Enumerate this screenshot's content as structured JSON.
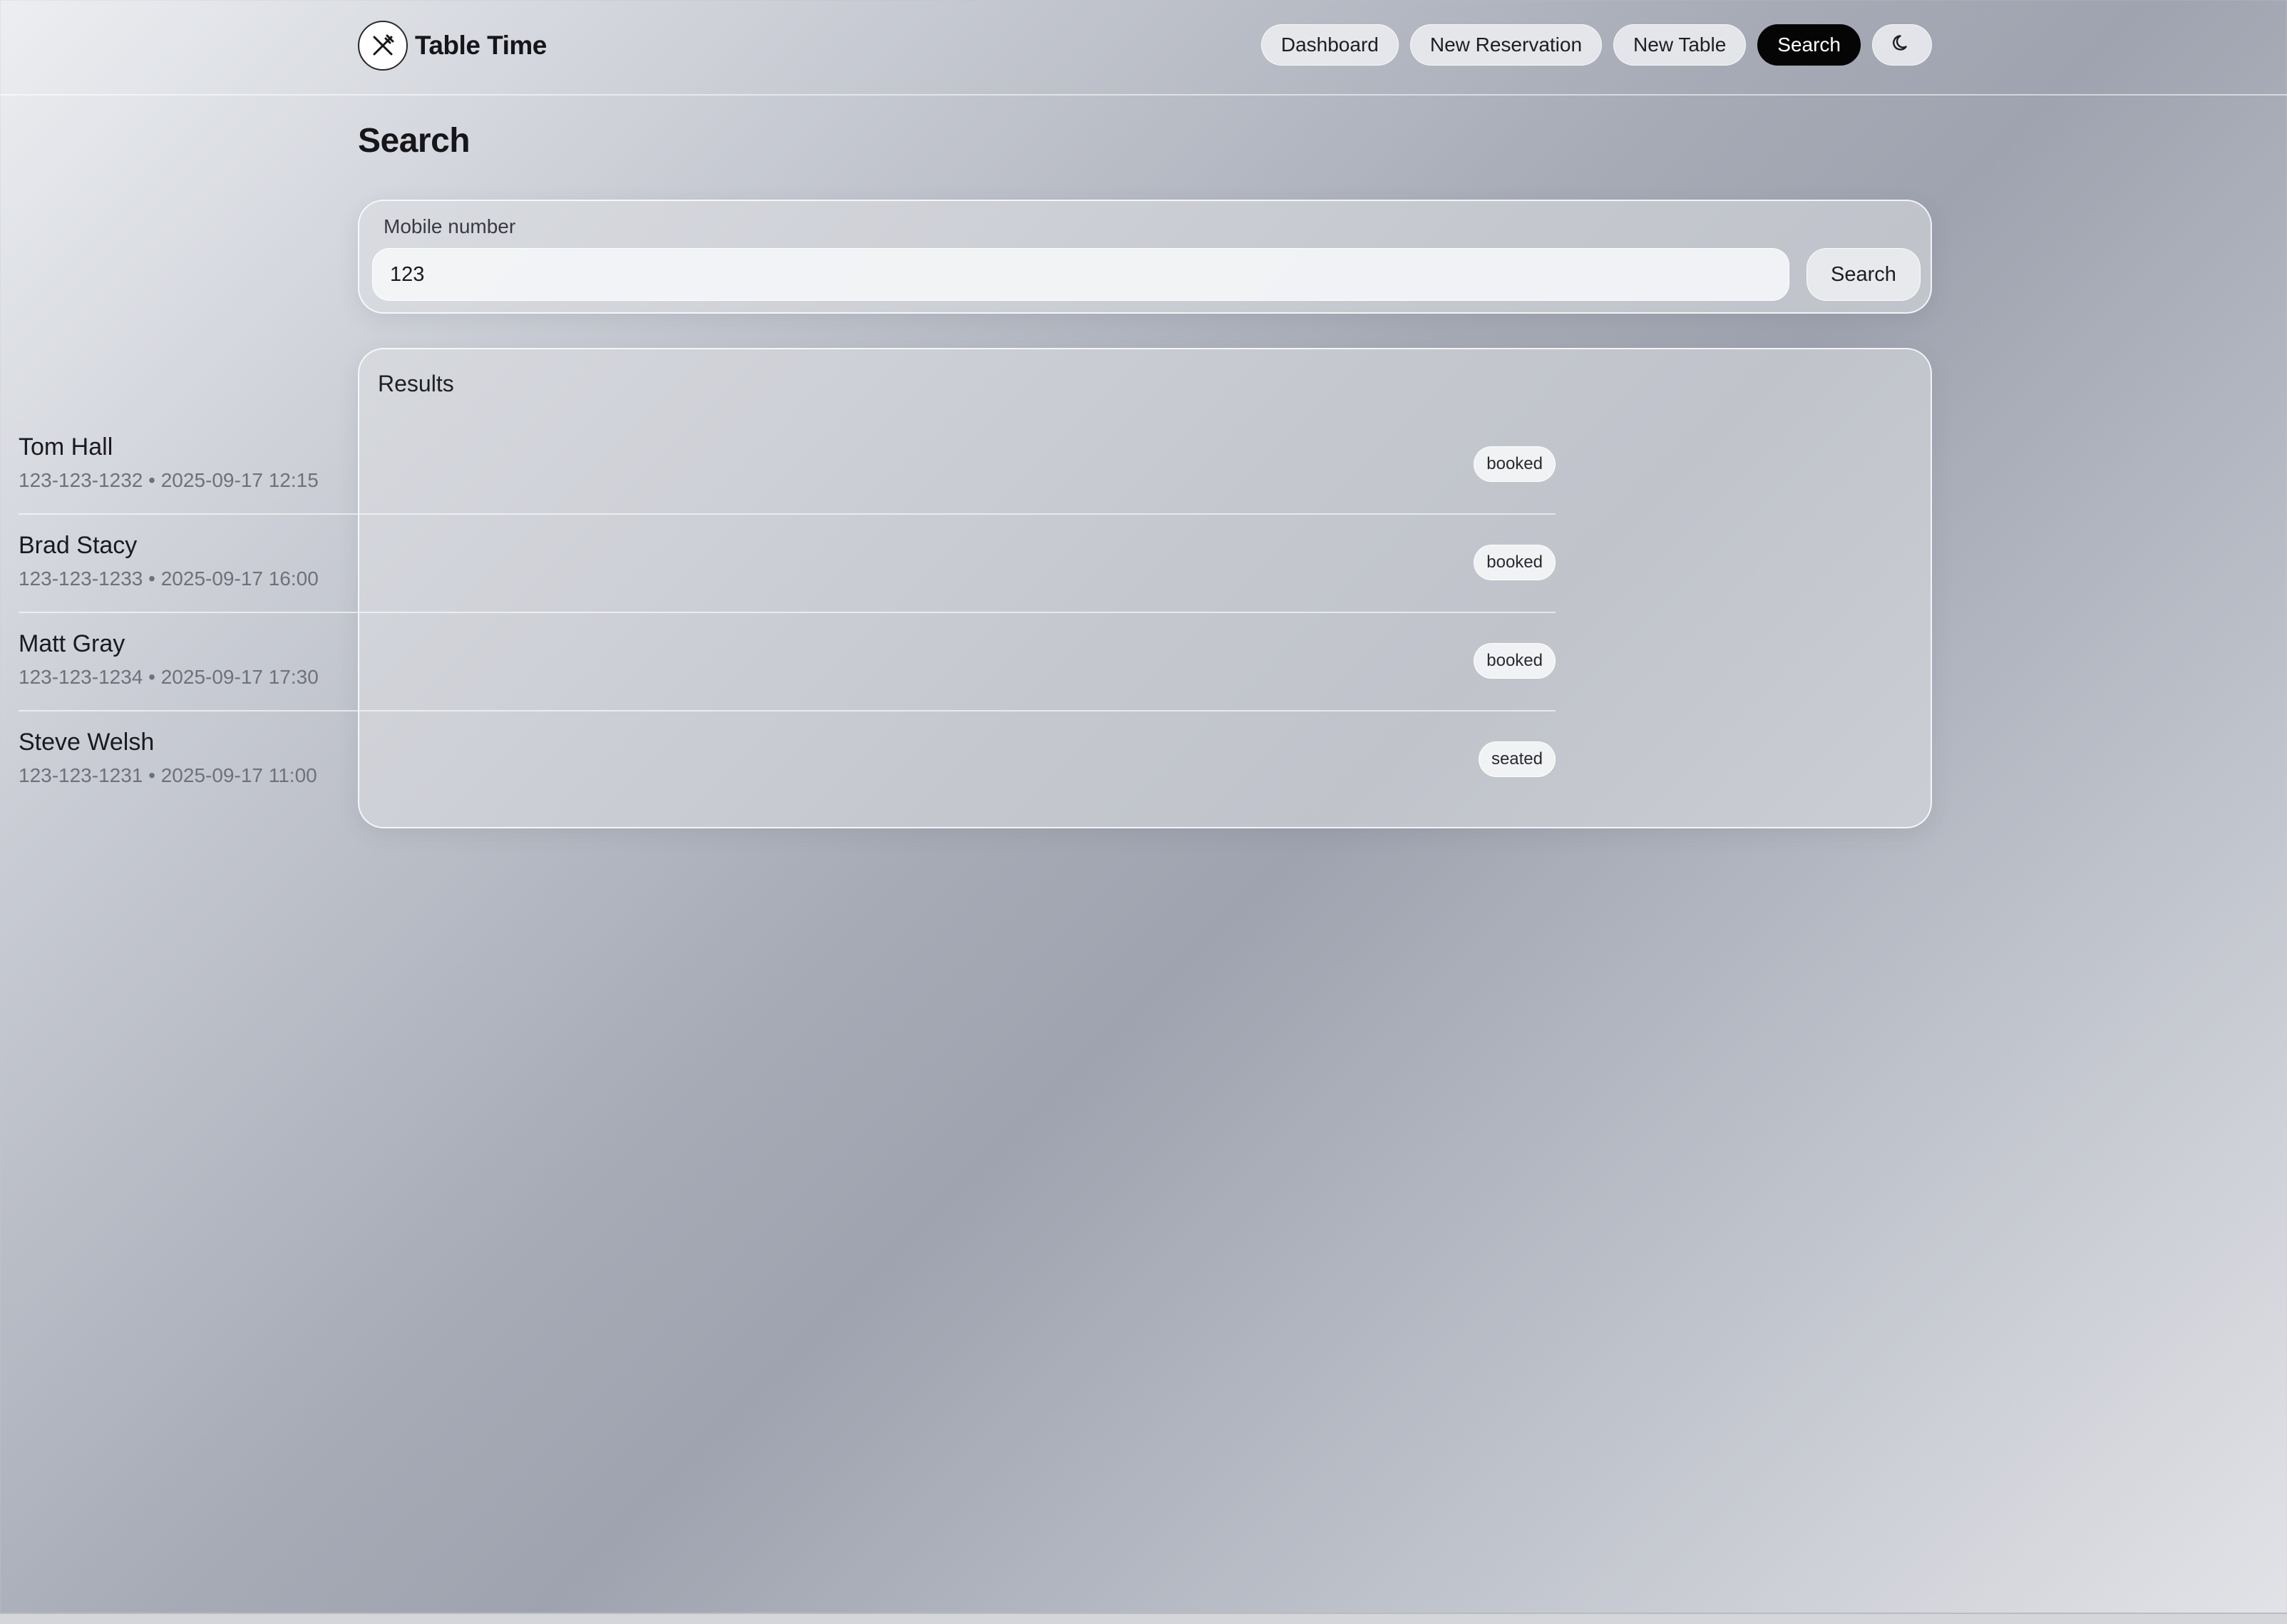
{
  "app": {
    "name": "Table Time",
    "logo_icon": "fork-knife-icon"
  },
  "nav": {
    "items": [
      {
        "label": "Dashboard",
        "active": false
      },
      {
        "label": "New Reservation",
        "active": false
      },
      {
        "label": "New Table",
        "active": false
      },
      {
        "label": "Search",
        "active": true
      }
    ],
    "theme_toggle_icon": "moon-icon"
  },
  "page": {
    "title": "Search"
  },
  "search": {
    "label": "Mobile number",
    "value": "123",
    "button_label": "Search"
  },
  "results": {
    "title": "Results",
    "items": [
      {
        "name": "Tom Hall",
        "phone": "123-123-1232",
        "datetime": "2025-09-17 12:15",
        "meta": "123-123-1232 • 2025-09-17 12:15",
        "status": "booked"
      },
      {
        "name": "Brad Stacy",
        "phone": "123-123-1233",
        "datetime": "2025-09-17 16:00",
        "meta": "123-123-1233 • 2025-09-17 16:00",
        "status": "booked"
      },
      {
        "name": "Matt Gray",
        "phone": "123-123-1234",
        "datetime": "2025-09-17 17:30",
        "meta": "123-123-1234 • 2025-09-17 17:30",
        "status": "booked"
      },
      {
        "name": "Steve Welsh",
        "phone": "123-123-1231",
        "datetime": "2025-09-17 11:00",
        "meta": "123-123-1231 • 2025-09-17 11:00",
        "status": "seated"
      }
    ]
  },
  "colors": {
    "active_nav_bg": "#050505",
    "active_nav_text": "#ffffff",
    "muted_text": "#6e717b"
  }
}
